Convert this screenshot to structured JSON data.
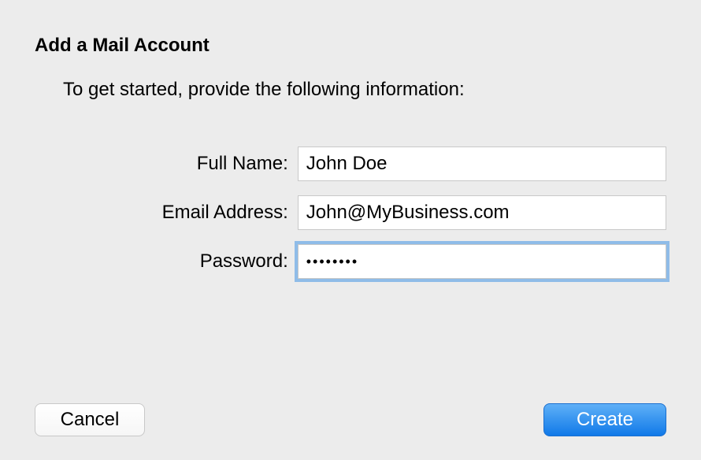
{
  "dialog": {
    "title": "Add a Mail Account",
    "subtitle": "To get started, provide the following information:"
  },
  "form": {
    "fullName": {
      "label": "Full Name:",
      "value": "John Doe"
    },
    "email": {
      "label": "Email Address:",
      "value": "John@MyBusiness.com"
    },
    "password": {
      "label": "Password:",
      "value": "••••••••"
    }
  },
  "buttons": {
    "cancel": "Cancel",
    "create": "Create"
  }
}
